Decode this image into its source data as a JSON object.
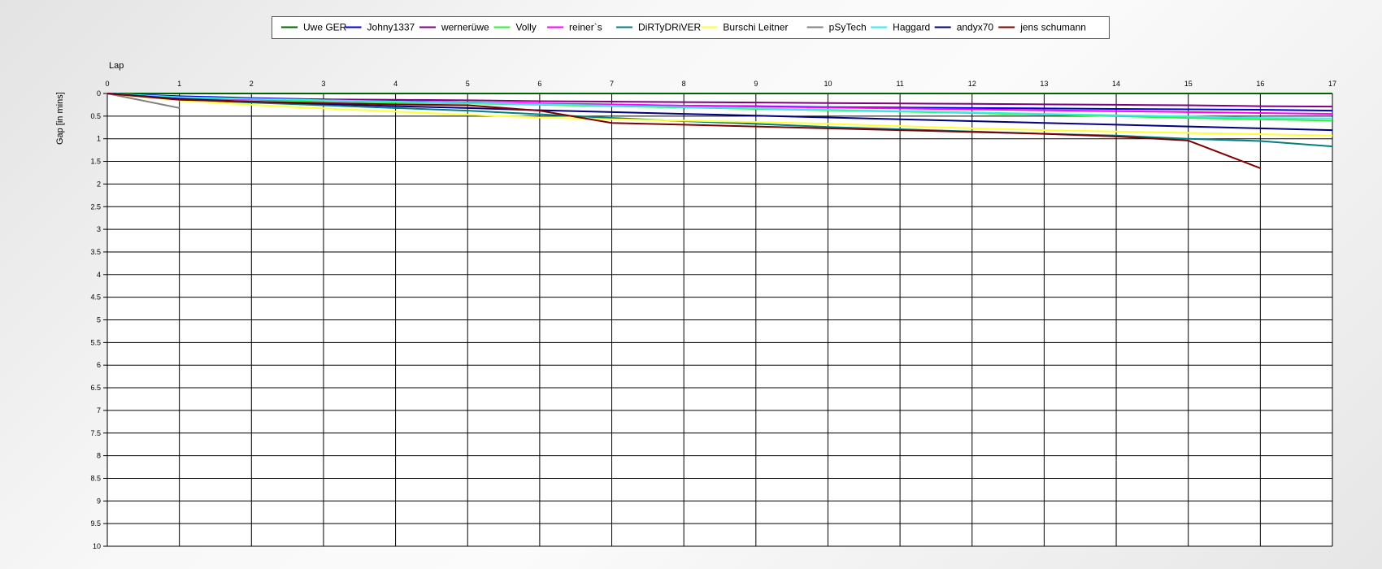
{
  "chart_data": {
    "type": "line",
    "xlabel": "Lap",
    "ylabel": "Gap [in mins]",
    "xlim": [
      0,
      17
    ],
    "ylim": [
      0,
      10
    ],
    "y_inverted": true,
    "grid": true,
    "legend_position": "top-center",
    "x_ticks": [
      0,
      1,
      2,
      3,
      4,
      5,
      6,
      7,
      8,
      9,
      10,
      11,
      12,
      13,
      14,
      15,
      16,
      17
    ],
    "y_ticks": [
      0,
      0.5,
      1,
      1.5,
      2,
      2.5,
      3,
      3.5,
      4,
      4.5,
      5,
      5.5,
      6,
      6.5,
      7,
      7.5,
      8,
      8.5,
      9,
      9.5,
      10
    ],
    "series": [
      {
        "name": "Uwe GER",
        "color": "#006400",
        "x": [
          0,
          1,
          2,
          3,
          4,
          5,
          6,
          7,
          8,
          9,
          10,
          11,
          12,
          13,
          14,
          15,
          16,
          17
        ],
        "y": [
          0,
          0,
          0,
          0,
          0,
          0,
          0,
          0,
          0,
          0,
          0,
          0,
          0,
          0,
          0,
          0,
          0,
          0
        ]
      },
      {
        "name": "Johny1337",
        "color": "#0000dd",
        "x": [
          0,
          1,
          2,
          3,
          4,
          5,
          6,
          7,
          8,
          9,
          10,
          11,
          12,
          13,
          14,
          15,
          16,
          17
        ],
        "y": [
          0,
          0.06,
          0.1,
          0.13,
          0.17,
          0.2,
          0.23,
          0.25,
          0.27,
          0.28,
          0.3,
          0.31,
          0.32,
          0.33,
          0.34,
          0.35,
          0.36,
          0.38
        ]
      },
      {
        "name": "wernerüwe",
        "color": "#800080",
        "x": [
          0,
          1,
          2,
          3,
          4,
          5,
          6,
          7,
          8,
          9,
          10,
          11,
          12,
          13,
          14,
          15,
          16,
          17
        ],
        "y": [
          0,
          0.09,
          0.12,
          0.13,
          0.14,
          0.15,
          0.17,
          0.18,
          0.19,
          0.2,
          0.21,
          0.22,
          0.23,
          0.24,
          0.25,
          0.26,
          0.28,
          0.29
        ]
      },
      {
        "name": "Volly",
        "color": "#33ee33",
        "x": [
          0,
          1,
          2,
          3,
          4,
          5,
          6,
          7,
          8,
          9,
          10,
          11,
          12,
          13,
          14,
          15,
          16,
          17
        ],
        "y": [
          0,
          0.1,
          0.14,
          0.17,
          0.2,
          0.22,
          0.25,
          0.28,
          0.31,
          0.34,
          0.37,
          0.4,
          0.43,
          0.47,
          0.5,
          0.54,
          0.57,
          0.6
        ]
      },
      {
        "name": "reiner`s",
        "color": "#ff00ff",
        "x": [
          0,
          1,
          2,
          3,
          4,
          5,
          6,
          7,
          8,
          9,
          10,
          11,
          12,
          13,
          14,
          15,
          16,
          17
        ],
        "y": [
          0,
          0.09,
          0.13,
          0.15,
          0.18,
          0.2,
          0.22,
          0.24,
          0.27,
          0.29,
          0.31,
          0.33,
          0.35,
          0.37,
          0.39,
          0.41,
          0.43,
          0.45
        ]
      },
      {
        "name": "DiRTyDRiVER",
        "color": "#008080",
        "x": [
          0,
          1,
          2,
          3,
          4,
          5,
          6,
          7,
          8,
          9,
          10,
          11,
          12,
          13,
          14,
          15,
          16,
          17
        ],
        "y": [
          0,
          0.14,
          0.2,
          0.26,
          0.32,
          0.38,
          0.46,
          0.54,
          0.61,
          0.67,
          0.74,
          0.79,
          0.84,
          0.89,
          0.93,
          1.0,
          1.05,
          1.17
        ]
      },
      {
        "name": "Burschi Leitner",
        "color": "#ffff33",
        "x": [
          0,
          1,
          2,
          3,
          4,
          5,
          6,
          7,
          8,
          9,
          10,
          11,
          12,
          13,
          14,
          15,
          16,
          17
        ],
        "y": [
          0,
          0.15,
          0.25,
          0.33,
          0.4,
          0.47,
          0.53,
          0.57,
          0.6,
          0.63,
          0.67,
          0.72,
          0.77,
          0.81,
          0.84,
          0.87,
          0.9,
          0.93
        ]
      },
      {
        "name": "pSyTech",
        "color": "#808080",
        "x": [
          0,
          1
        ],
        "y": [
          0,
          0.32
        ]
      },
      {
        "name": "Haggard",
        "color": "#33eeee",
        "x": [
          0,
          1,
          2,
          3,
          4,
          5,
          6,
          7,
          8,
          9,
          10,
          11,
          12,
          13,
          14,
          15,
          16,
          17
        ],
        "y": [
          0,
          0.08,
          0.12,
          0.15,
          0.18,
          0.21,
          0.24,
          0.27,
          0.3,
          0.33,
          0.36,
          0.39,
          0.42,
          0.45,
          0.48,
          0.51,
          0.54,
          0.55
        ]
      },
      {
        "name": "andyx70",
        "color": "#000080",
        "x": [
          0,
          1,
          2,
          3,
          4,
          5,
          6,
          7,
          8,
          9,
          10,
          11,
          12,
          13,
          14,
          15,
          16,
          17
        ],
        "y": [
          0,
          0.12,
          0.18,
          0.23,
          0.28,
          0.32,
          0.37,
          0.41,
          0.45,
          0.49,
          0.53,
          0.57,
          0.61,
          0.65,
          0.69,
          0.73,
          0.77,
          0.81
        ]
      },
      {
        "name": "jens  schumann",
        "color": "#800000",
        "x": [
          0,
          1,
          2,
          3,
          4,
          5,
          6,
          7,
          8,
          9,
          10,
          11,
          12,
          13,
          14,
          15,
          16
        ],
        "y": [
          0,
          0.14,
          0.18,
          0.21,
          0.24,
          0.26,
          0.38,
          0.65,
          0.69,
          0.73,
          0.77,
          0.81,
          0.85,
          0.89,
          0.95,
          1.04,
          1.65
        ]
      }
    ]
  }
}
